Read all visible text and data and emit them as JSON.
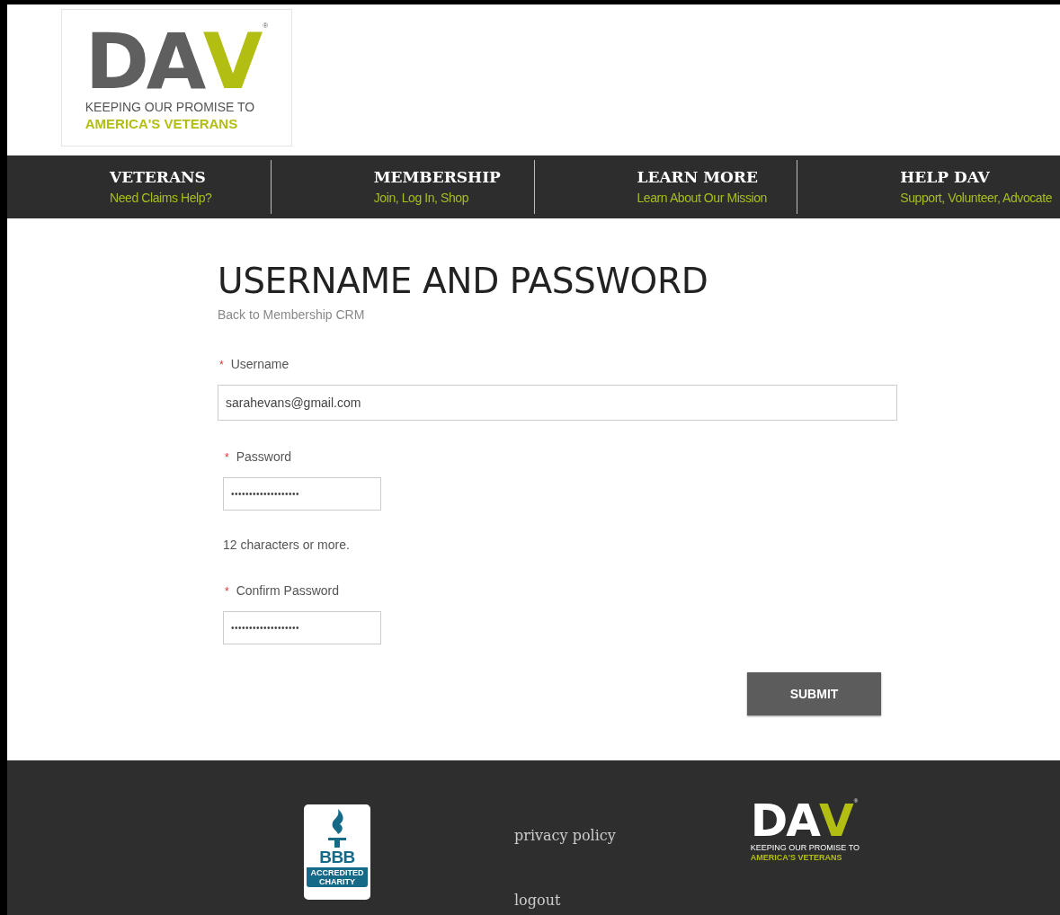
{
  "logo": {
    "letters": "DA",
    "accent_letter": "V",
    "registered": "®",
    "tagline": "KEEPING OUR PROMISE TO",
    "tagline_accent": "AMERICA'S VETERANS"
  },
  "nav": [
    {
      "title": "VETERANS",
      "subtitle": "Need Claims Help?"
    },
    {
      "title": "MEMBERSHIP",
      "subtitle": "Join, Log In, Shop"
    },
    {
      "title": "LEARN MORE",
      "subtitle": "Learn About Our Mission"
    },
    {
      "title": "HELP DAV",
      "subtitle": "Support, Volunteer, Advocate"
    }
  ],
  "heading": "USERNAME AND PASSWORD",
  "back_link": "Back to Membership CRM",
  "fields": [
    {
      "kind": "text",
      "required_mark": "*",
      "label": "Username",
      "value": "sarahevans@gmail.com"
    },
    {
      "kind": "password",
      "required_mark": "*",
      "label": "Password",
      "value": "•••••••••••••••••••",
      "hint": "12 characters or more."
    },
    {
      "kind": "password",
      "required_mark": "*",
      "label": "Confirm Password",
      "value": "•••••••••••••••••••"
    }
  ],
  "submit": "SUBMIT",
  "footer": {
    "bbb": {
      "letters": "BBB",
      "badge": "ACCREDITED CHARITY"
    },
    "links": [
      "privacy policy",
      "logout"
    ],
    "logo": {
      "letters": "DA",
      "accent_letter": "V",
      "registered": "®",
      "tagline": "KEEPING OUR PROMISE TO",
      "tagline_accent": "AMERICA'S VETERANS"
    }
  }
}
